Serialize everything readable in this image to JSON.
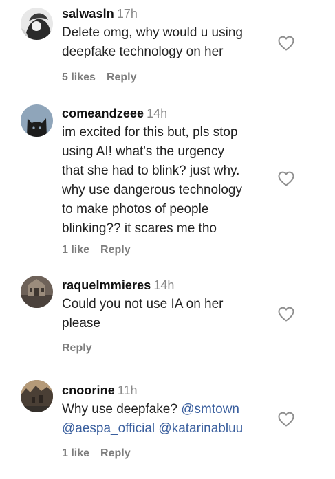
{
  "comments": [
    {
      "username": "salwasln",
      "time": "17h",
      "text_lines": [
        "Delete omg, why would u using",
        "deepfake technology on her"
      ],
      "likes": "5 likes",
      "reply": "Reply"
    },
    {
      "username": "comeandzeee",
      "time": "14h",
      "text_lines": [
        "im excited for this but, pls stop",
        "using AI! what's the urgency",
        "that she had to blink? just why.",
        "why use dangerous technology",
        "to make photos of people",
        "blinking?? it scares me tho"
      ],
      "likes": "1 like",
      "reply": "Reply"
    },
    {
      "username": "raquelmmieres",
      "time": "14h",
      "text_lines": [
        "Could you not use IA on her",
        "please"
      ],
      "likes": "",
      "reply": "Reply"
    },
    {
      "username": "cnoorine",
      "time": "11h",
      "text_line1_prefix": "Why use deepfake?",
      "mention_1": "@smtown",
      "mention_2": "@aespa_official",
      "mention_3": "@katarinabluu",
      "likes": "1 like",
      "reply": "Reply"
    }
  ],
  "icons": {
    "like": "heart-outline-icon"
  },
  "colors": {
    "username": "#111111",
    "meta": "#8a8a8a",
    "mention": "#3a5f9e",
    "action": "#7c7c7c"
  }
}
